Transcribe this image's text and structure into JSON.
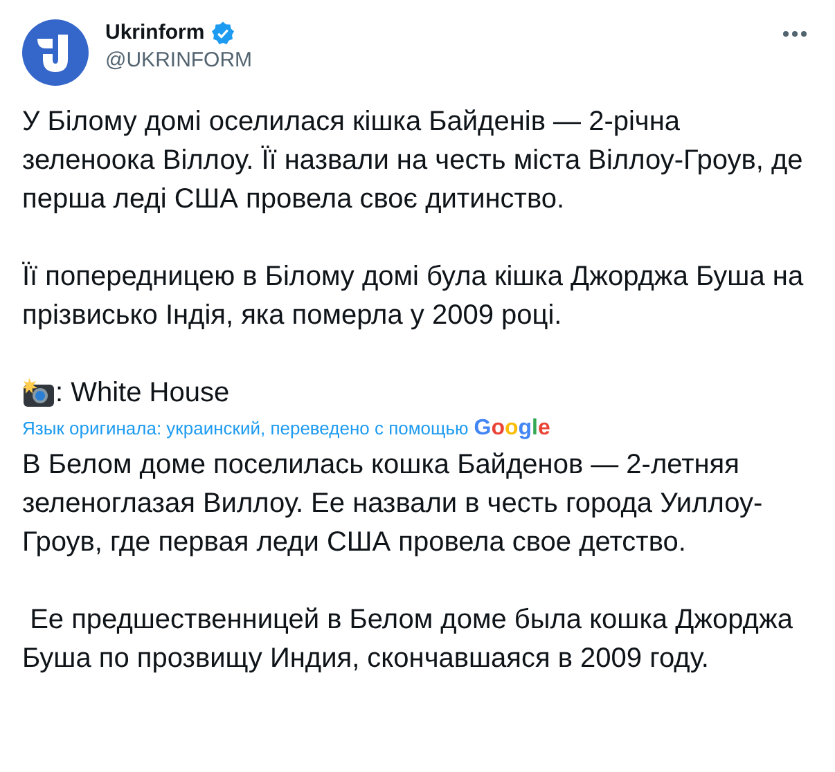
{
  "author": {
    "name": "Ukrinform",
    "verified": true,
    "handle": "@UKRINFORM"
  },
  "original_paragraphs": [
    "У Білому домі оселилася кішка Байденів — 2-річна зеленоока Віллоу. Її назвали на честь міста Віллоу-Гроув, де перша леді США провела своє дитинство.",
    "Її попередницею в Білому домі була кішка Джорджа Буша на прізвисько Індія, яка померла у 2009 році."
  ],
  "photo_credit": ": White House",
  "translation_note": {
    "text": "Язык оригинала: украинский, переведено с помощью",
    "provider": "Google"
  },
  "translated_paragraphs": [
    "В Белом доме поселилась кошка Байденов — 2-летняя зеленоглазая Виллоу. Ее назвали в честь города Уиллоу-Гроув, где первая леди США провела свое детство.",
    " Ее предшественницей в Белом доме была кошка Джорджа Буша по прозвищу Индия, скончавшаяся в 2009 году."
  ]
}
